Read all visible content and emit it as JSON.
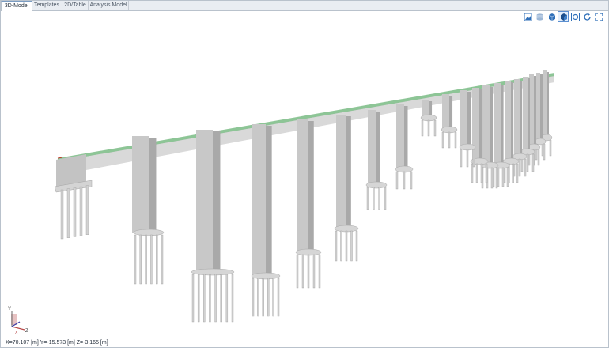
{
  "tabs": [
    {
      "label": "3D-Model",
      "active": true
    },
    {
      "label": "Templates",
      "active": false
    },
    {
      "label": "2D/Table",
      "active": false
    },
    {
      "label": "Analysis Model",
      "active": false
    }
  ],
  "toolbar": {
    "icons": [
      "picture-icon",
      "layer-icon",
      "solid-cube-icon",
      "shaded-cube-icon",
      "rotate-icon",
      "refresh-icon",
      "fullscreen-icon"
    ]
  },
  "axis": {
    "x": "X",
    "y": "Y",
    "z": "Z"
  },
  "status": {
    "coordinates": "X=70.107 [m]  Y=-15.573 [m]  Z=-3.165 [m]"
  },
  "colors": {
    "deck": "#8dc596",
    "pier": "#c8c8c8",
    "pier_shadow": "#a9a9a9",
    "pile": "#d2d2d2"
  }
}
